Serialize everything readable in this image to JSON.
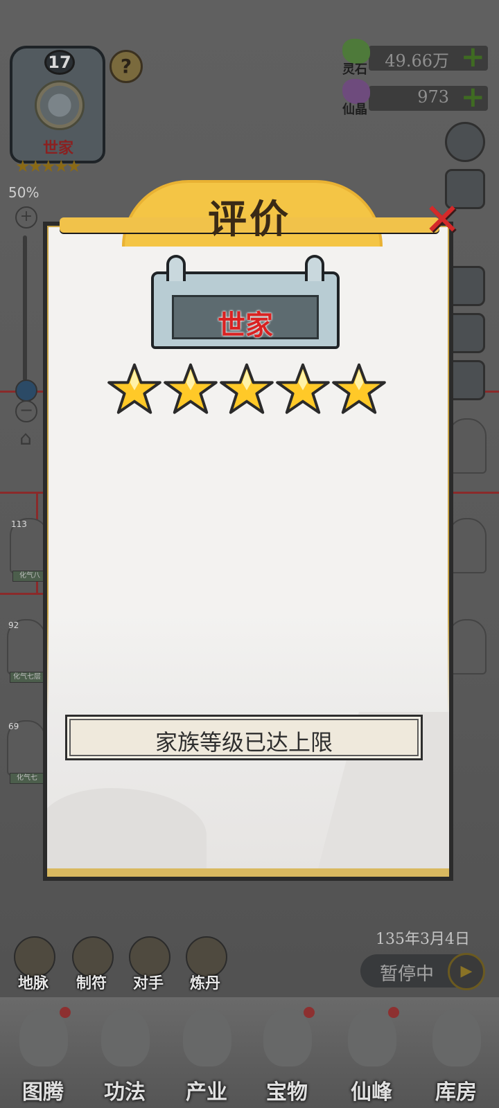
{
  "crest": {
    "level": "17",
    "rank": "世家",
    "stars": "★★★★★",
    "help": "?"
  },
  "zoom": {
    "percent": "50%",
    "plus": "+",
    "minus": "−"
  },
  "resources": [
    {
      "name": "灵石",
      "value": "49.66万",
      "color": "#4e7a3a"
    },
    {
      "name": "仙晶",
      "value": "973",
      "color": "#6e4b7d"
    }
  ],
  "side_portraits": [
    {
      "level": "113",
      "tag": "化气八"
    },
    {
      "level": "92",
      "tag": "化气七层"
    },
    {
      "level": "69",
      "tag": "化气七"
    }
  ],
  "date": "135年3月4日",
  "pause": {
    "label": "暂停中",
    "icon": "play-icon"
  },
  "tools": [
    {
      "label": "地脉"
    },
    {
      "label": "制符"
    },
    {
      "label": "对手"
    },
    {
      "label": "炼丹"
    }
  ],
  "nav": [
    {
      "label": "图腾",
      "dot": true
    },
    {
      "label": "功法",
      "dot": false
    },
    {
      "label": "产业",
      "dot": false
    },
    {
      "label": "宝物",
      "dot": true
    },
    {
      "label": "仙峰",
      "dot": true
    },
    {
      "label": "库房",
      "dot": false
    }
  ],
  "modal": {
    "title": "评价",
    "rank": "世家",
    "star_count": 5,
    "max_level_message": "家族等级已达上限",
    "close_icon": "close-icon"
  },
  "colors": {
    "accent_gold": "#f4c545",
    "rank_red": "#d92222",
    "close_red": "#d42a2a"
  }
}
